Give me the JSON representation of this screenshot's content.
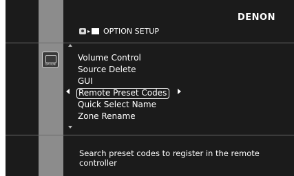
{
  "brand": "DENON",
  "header": {
    "title": "OPTION SETUP",
    "separator": "▸"
  },
  "sidebar": {
    "icon_label": "OPTION"
  },
  "menu": {
    "items": [
      {
        "label": "Volume Control"
      },
      {
        "label": "Source Delete"
      },
      {
        "label": "GUI"
      },
      {
        "label": "Remote Preset Codes"
      },
      {
        "label": "Quick Select Name"
      },
      {
        "label": "Zone Rename"
      }
    ],
    "selected_index": 3
  },
  "description": "Search preset codes to register in the remote controller"
}
